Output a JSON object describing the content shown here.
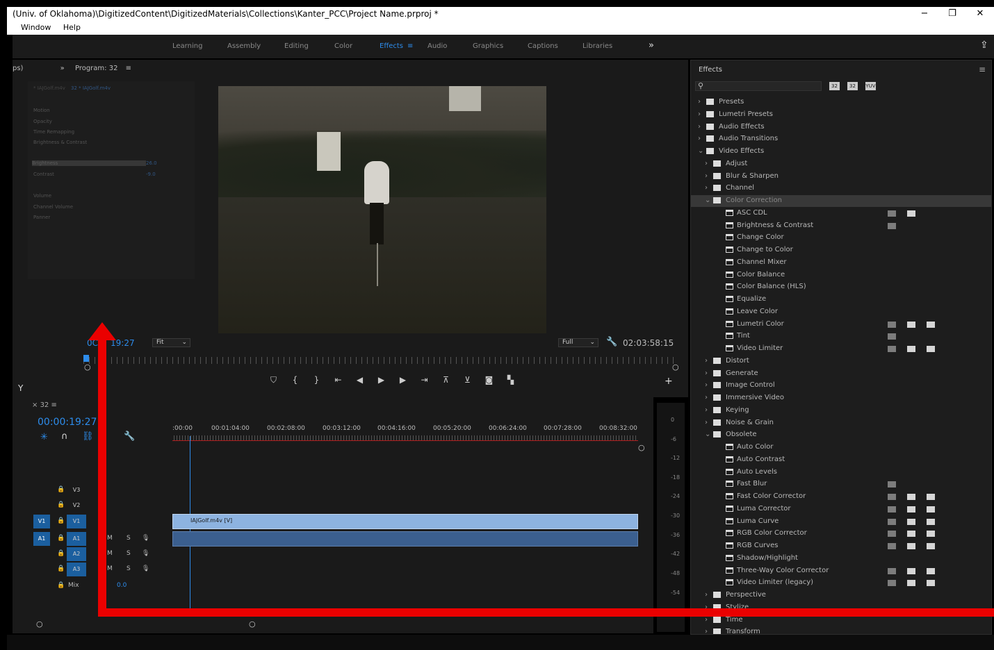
{
  "titlebar": {
    "title": "(Univ. of Oklahoma)\\DigitizedContent\\DigitizedMaterials\\Collections\\Kanter_PCC\\Project Name.prproj *",
    "min": "−",
    "max": "❐",
    "close": "✕"
  },
  "menubar": {
    "items": [
      "Window",
      "Help"
    ]
  },
  "workspaces": {
    "items": [
      {
        "label": "Learning"
      },
      {
        "label": "Assembly"
      },
      {
        "label": "Editing"
      },
      {
        "label": "Color"
      },
      {
        "label": "Effects"
      },
      {
        "label": "Audio"
      },
      {
        "label": "Graphics"
      },
      {
        "label": "Captions"
      },
      {
        "label": "Libraries"
      }
    ],
    "active": "Effects",
    "more": "»"
  },
  "program": {
    "tab_prefix": "ps)",
    "more": "»",
    "title": "Program: 32",
    "menu": "≡",
    "timecode": "00:00:19:27",
    "timecode_visible": "19:27",
    "timecode_prefix": "0C",
    "fit": "Fit",
    "quality": "Full",
    "duration": "02:03:58:15"
  },
  "effect_controls": {
    "source": "* IAJGolf.m4v",
    "sequence": "32 * IAJGolf.m4v",
    "rows": [
      "Motion",
      "Opacity",
      "Time Remapping",
      "Brightness & Contrast",
      "Brightness",
      "Contrast",
      "Volume",
      "Channel Volume",
      "Panner"
    ],
    "brightness_value": "26.0",
    "contrast_value": "-9.0"
  },
  "timeline": {
    "tab": "32",
    "timecode": "00:00:19:27",
    "ruler": [
      ":00:00",
      "00:01:04:00",
      "00:02:08:00",
      "00:03:12:00",
      "00:04:16:00",
      "00:05:20:00",
      "00:06:24:00",
      "00:07:28:00",
      "00:08:32:00"
    ],
    "tracks": [
      {
        "name": "V3"
      },
      {
        "name": "V2"
      },
      {
        "name": "V1",
        "target": "V1"
      },
      {
        "name": "A1",
        "target": "A1"
      },
      {
        "name": "A2"
      },
      {
        "name": "A3"
      }
    ],
    "mix_label": "Mix",
    "mix_value": "0.0",
    "clip_video": "IAJGolf.m4v [V]",
    "m": "M",
    "s": "S"
  },
  "meter": {
    "labels": [
      "0",
      "-6",
      "-12",
      "-18",
      "-24",
      "-30",
      "-36",
      "-42",
      "-48",
      "-54"
    ]
  },
  "effects_panel": {
    "title": "Effects",
    "menu": "≡",
    "filter_buttons": [
      "32",
      "32",
      "YUV"
    ],
    "tree": [
      {
        "label": "Presets",
        "depth": 0,
        "arrow": "›",
        "kind": "star"
      },
      {
        "label": "Lumetri Presets",
        "depth": 0,
        "arrow": "›",
        "kind": "star"
      },
      {
        "label": "Audio Effects",
        "depth": 0,
        "arrow": "›",
        "kind": "folder"
      },
      {
        "label": "Audio Transitions",
        "depth": 0,
        "arrow": "›",
        "kind": "folder"
      },
      {
        "label": "Video Effects",
        "depth": 0,
        "arrow": "⌄",
        "kind": "folder"
      },
      {
        "label": "Adjust",
        "depth": 1,
        "arrow": "›",
        "kind": "folder"
      },
      {
        "label": "Blur & Sharpen",
        "depth": 1,
        "arrow": "›",
        "kind": "folder"
      },
      {
        "label": "Channel",
        "depth": 1,
        "arrow": "›",
        "kind": "folder"
      },
      {
        "label": "Color Correction",
        "depth": 1,
        "arrow": "⌄",
        "kind": "folder",
        "selected": true
      },
      {
        "label": "ASC CDL",
        "depth": 2,
        "kind": "fx",
        "acc": [
          1,
          2
        ]
      },
      {
        "label": "Brightness & Contrast",
        "depth": 2,
        "kind": "fx",
        "acc": [
          1
        ]
      },
      {
        "label": "Change Color",
        "depth": 2,
        "kind": "fx"
      },
      {
        "label": "Change to Color",
        "depth": 2,
        "kind": "fx"
      },
      {
        "label": "Channel Mixer",
        "depth": 2,
        "kind": "fx"
      },
      {
        "label": "Color Balance",
        "depth": 2,
        "kind": "fx"
      },
      {
        "label": "Color Balance (HLS)",
        "depth": 2,
        "kind": "fx"
      },
      {
        "label": "Equalize",
        "depth": 2,
        "kind": "fx"
      },
      {
        "label": "Leave Color",
        "depth": 2,
        "kind": "fx"
      },
      {
        "label": "Lumetri Color",
        "depth": 2,
        "kind": "fx",
        "acc": [
          1,
          2,
          3
        ]
      },
      {
        "label": "Tint",
        "depth": 2,
        "kind": "fx",
        "acc": [
          1
        ]
      },
      {
        "label": "Video Limiter",
        "depth": 2,
        "kind": "fx",
        "acc": [
          1,
          2,
          3
        ]
      },
      {
        "label": "Distort",
        "depth": 1,
        "arrow": "›",
        "kind": "folder"
      },
      {
        "label": "Generate",
        "depth": 1,
        "arrow": "›",
        "kind": "folder"
      },
      {
        "label": "Image Control",
        "depth": 1,
        "arrow": "›",
        "kind": "folder"
      },
      {
        "label": "Immersive Video",
        "depth": 1,
        "arrow": "›",
        "kind": "folder"
      },
      {
        "label": "Keying",
        "depth": 1,
        "arrow": "›",
        "kind": "folder"
      },
      {
        "label": "Noise & Grain",
        "depth": 1,
        "arrow": "›",
        "kind": "folder"
      },
      {
        "label": "Obsolete",
        "depth": 1,
        "arrow": "⌄",
        "kind": "folder"
      },
      {
        "label": "Auto Color",
        "depth": 2,
        "kind": "fx"
      },
      {
        "label": "Auto Contrast",
        "depth": 2,
        "kind": "fx"
      },
      {
        "label": "Auto Levels",
        "depth": 2,
        "kind": "fx"
      },
      {
        "label": "Fast Blur",
        "depth": 2,
        "kind": "fx",
        "acc": [
          1
        ]
      },
      {
        "label": "Fast Color Corrector",
        "depth": 2,
        "kind": "fx",
        "acc": [
          1,
          2,
          3
        ]
      },
      {
        "label": "Luma Corrector",
        "depth": 2,
        "kind": "fx",
        "acc": [
          1,
          2,
          3
        ]
      },
      {
        "label": "Luma Curve",
        "depth": 2,
        "kind": "fx",
        "acc": [
          1,
          2,
          3
        ]
      },
      {
        "label": "RGB Color Corrector",
        "depth": 2,
        "kind": "fx",
        "acc": [
          1,
          2,
          3
        ]
      },
      {
        "label": "RGB Curves",
        "depth": 2,
        "kind": "fx",
        "acc": [
          1,
          2,
          3
        ]
      },
      {
        "label": "Shadow/Highlight",
        "depth": 2,
        "kind": "fx"
      },
      {
        "label": "Three-Way Color Corrector",
        "depth": 2,
        "kind": "fx",
        "acc": [
          1,
          2,
          3
        ]
      },
      {
        "label": "Video Limiter (legacy)",
        "depth": 2,
        "kind": "fx",
        "acc": [
          1,
          2,
          3
        ]
      },
      {
        "label": "Perspective",
        "depth": 1,
        "arrow": "›",
        "kind": "folder"
      },
      {
        "label": "Stylize",
        "depth": 1,
        "arrow": "›",
        "kind": "folder"
      },
      {
        "label": "Time",
        "depth": 1,
        "arrow": "›",
        "kind": "folder"
      },
      {
        "label": "Transform",
        "depth": 1,
        "arrow": "›",
        "kind": "folder"
      }
    ]
  },
  "annotation": {
    "color": "#ea0000"
  },
  "colors": {
    "accent": "#2d8ceb",
    "track_target": "#1b5f9f",
    "clip_video": "#8db3e0",
    "clip_audio": "#3b5f8f"
  }
}
